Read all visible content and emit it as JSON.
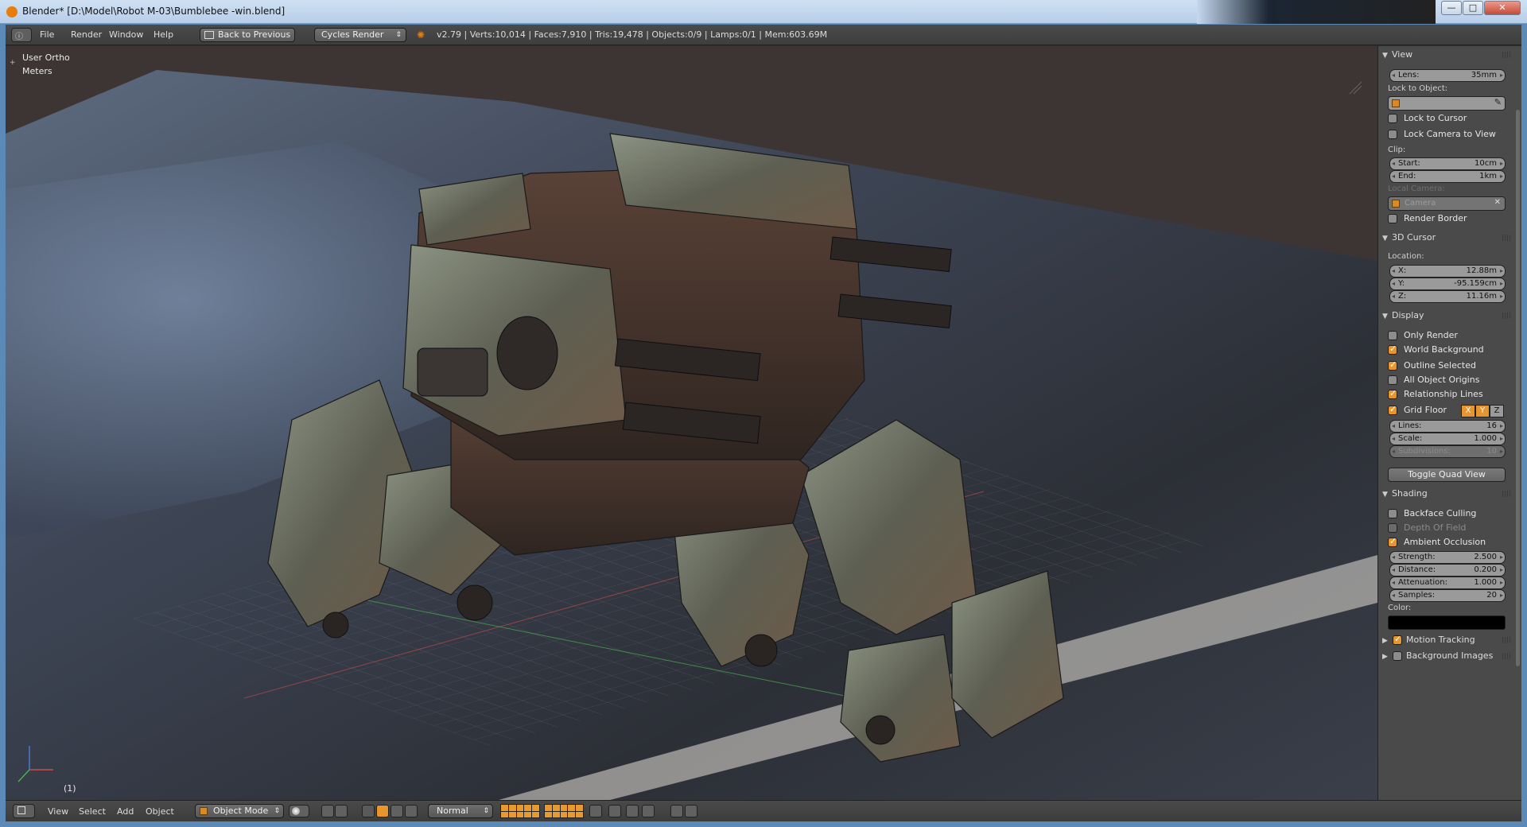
{
  "window": {
    "title": "Blender* [D:\\Model\\Robot M-03\\Bumblebee -win.blend]",
    "controls": {
      "minimize": "—",
      "maximize": "□",
      "close": "✕"
    }
  },
  "info_header": {
    "menus": [
      "File",
      "Render",
      "Window",
      "Help"
    ],
    "back_button": "Back to Previous",
    "render_engine": "Cycles Render",
    "stats": "v2.79 | Verts:10,014 | Faces:7,910 | Tris:19,478 | Objects:0/9 | Lamps:0/1 | Mem:603.69M"
  },
  "viewport": {
    "view_name": "User Ortho",
    "units": "Meters",
    "frame": "(1)"
  },
  "properties": {
    "view": {
      "header": "View",
      "lens_label": "Lens:",
      "lens_value": "35mm",
      "lock_object_label": "Lock to Object:",
      "lock_to_cursor": "Lock to Cursor",
      "lock_to_cursor_checked": false,
      "lock_camera": "Lock Camera to View",
      "lock_camera_checked": false,
      "clip_label": "Clip:",
      "start_label": "Start:",
      "start_value": "10cm",
      "end_label": "End:",
      "end_value": "1km",
      "local_camera_label": "Local Camera:",
      "camera_value": "Camera",
      "render_border": "Render Border",
      "render_border_checked": false
    },
    "cursor": {
      "header": "3D Cursor",
      "location_label": "Location:",
      "x_label": "X:",
      "x_value": "12.88m",
      "y_label": "Y:",
      "y_value": "-95.159cm",
      "z_label": "Z:",
      "z_value": "11.16m"
    },
    "display": {
      "header": "Display",
      "checks": [
        {
          "label": "Only Render",
          "checked": false
        },
        {
          "label": "World Background",
          "checked": true
        },
        {
          "label": "Outline Selected",
          "checked": true
        },
        {
          "label": "All Object Origins",
          "checked": false
        },
        {
          "label": "Relationship Lines",
          "checked": true
        }
      ],
      "grid_floor": "Grid Floor",
      "grid_floor_checked": true,
      "axis_x": "X",
      "axis_y": "Y",
      "axis_z": "Z",
      "lines_label": "Lines:",
      "lines_value": "16",
      "scale_label": "Scale:",
      "scale_value": "1.000",
      "subdivisions_label": "Subdivisions:",
      "subdivisions_value": "10",
      "toggle_quad": "Toggle Quad View"
    },
    "shading": {
      "header": "Shading",
      "backface": "Backface Culling",
      "backface_checked": false,
      "dof": "Depth Of Field",
      "dof_checked": false,
      "ao": "Ambient Occlusion",
      "ao_checked": true,
      "strength_label": "Strength:",
      "strength_value": "2.500",
      "distance_label": "Distance:",
      "distance_value": "0.200",
      "attenuation_label": "Attenuation:",
      "attenuation_value": "1.000",
      "samples_label": "Samples:",
      "samples_value": "20",
      "color_label": "Color:",
      "color_value": "#000000"
    },
    "motion_tracking": "Motion Tracking",
    "motion_tracking_checked": true,
    "background_images": "Background Images",
    "background_images_checked": false
  },
  "bottom_header": {
    "menus": [
      "View",
      "Select",
      "Add",
      "Object"
    ],
    "mode": "Object Mode",
    "pivot": "Normal"
  },
  "colors": {
    "accent": "#e7952c",
    "blender_orange": "#e87d0d",
    "panel_bg": "#4a4a4a",
    "header_bg": "#3e3e3e"
  }
}
